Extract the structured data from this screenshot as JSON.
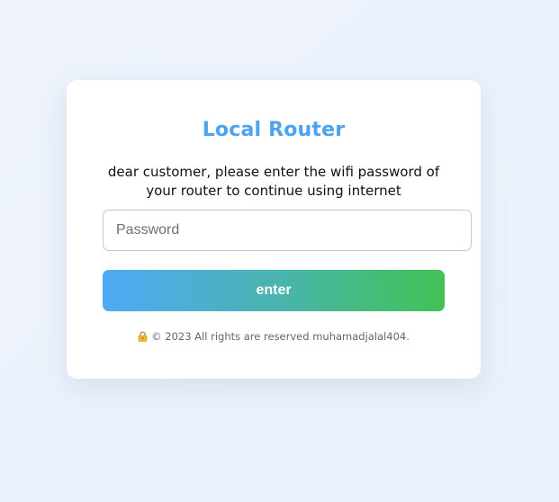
{
  "card": {
    "title": "Local Router",
    "message": "dear customer, please enter the wifi password of your router to continue using internet",
    "password": {
      "value": "",
      "placeholder": "Password"
    },
    "enter_label": "enter",
    "footer": {
      "icon": "lock-icon",
      "text": "© 2023 All rights are reserved muhamadjalal404."
    }
  },
  "colors": {
    "title": "#4ca3ef",
    "button_gradient_start": "#4eaaf6",
    "button_gradient_end": "#42c254",
    "background": "#eef3fb"
  }
}
